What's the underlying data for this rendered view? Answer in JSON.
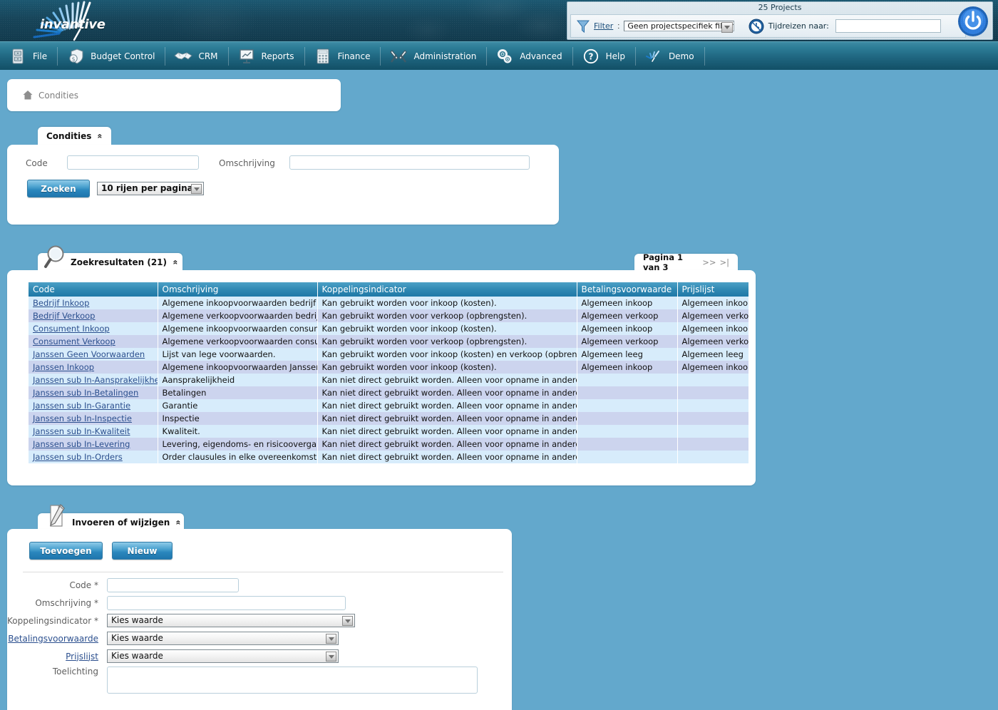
{
  "header": {
    "logo_text": "invantive",
    "project_count": "25 Projects",
    "filter_label": "Filter",
    "filter_colon": ":",
    "filter_value": "Geen projectspecifiek filter",
    "timetravel_label": "Tijdreizen naar:",
    "timetravel_value": ""
  },
  "menu": [
    {
      "icon": "cabinet-icon",
      "label": "File"
    },
    {
      "icon": "money-shield-icon",
      "label": "Budget Control"
    },
    {
      "icon": "handshake-icon",
      "label": "CRM"
    },
    {
      "icon": "presentation-chart-icon",
      "label": "Reports"
    },
    {
      "icon": "calculator-icon",
      "label": "Finance"
    },
    {
      "icon": "tools-icon",
      "label": "Administration"
    },
    {
      "icon": "gears-icon",
      "label": "Advanced"
    },
    {
      "icon": "question-mark-icon",
      "label": "Help"
    },
    {
      "icon": "invantive-mark-icon",
      "label": "Demo"
    }
  ],
  "breadcrumb": {
    "icon": "home-icon",
    "label": "Condities"
  },
  "search_panel": {
    "tab_title": "Condities",
    "collapse_glyph": "«",
    "code_label": "Code",
    "code_value": "",
    "omschrijving_label": "Omschrijving",
    "omschrijving_value": "",
    "search_button": "Zoeken",
    "rows_per_page": "10 rijen per pagina"
  },
  "results_panel": {
    "tab_icon": "magnifier-icon",
    "tab_title": "Zoekresultaten (21)",
    "collapse_glyph": "«",
    "pager_text": "Pagina 1 van 3",
    "pager_next": ">>",
    "pager_last": ">|",
    "columns": [
      "Code",
      "Omschrijving",
      "Koppelingsindicator",
      "Betalingsvoorwaarde",
      "Prijslijst"
    ],
    "rows": [
      [
        "Bedrijf Inkoop",
        "Algemene inkoopvoorwaarden bedrijf",
        "Kan gebruikt worden voor inkoop (kosten).",
        "Algemeen inkoop",
        "Algemeen inkoop"
      ],
      [
        "Bedrijf Verkoop",
        "Algemene verkoopvoorwaarden bedrijf",
        "Kan gebruikt worden voor verkoop (opbrengsten).",
        "Algemeen verkoop",
        "Algemeen verkoop"
      ],
      [
        "Consument Inkoop",
        "Algemene inkoopvoorwaarden consument",
        "Kan gebruikt worden voor inkoop (kosten).",
        "Algemeen inkoop",
        "Algemeen inkoop"
      ],
      [
        "Consument Verkoop",
        "Algemene verkoopvoorwaarden consument",
        "Kan gebruikt worden voor verkoop (opbrengsten).",
        "Algemeen verkoop",
        "Algemeen verkoop"
      ],
      [
        "Janssen Geen Voorwaarden",
        "Lijst van lege voorwaarden.",
        "Kan gebruikt worden voor inkoop (kosten) en verkoop (opbrengsten).",
        "Algemeen leeg",
        "Algemeen leeg"
      ],
      [
        "Janssen Inkoop",
        "Algemene inkoopvoorwaarden Janssen",
        "Kan gebruikt worden voor inkoop (kosten).",
        "Algemeen inkoop",
        "Algemeen inkoop"
      ],
      [
        "Janssen sub In-Aansprakelijkheid",
        "Aansprakelijkheid",
        "Kan niet direct gebruikt worden. Alleen voor opname in andere condities.",
        "",
        ""
      ],
      [
        "Janssen sub In-Betalingen",
        "Betalingen",
        "Kan niet direct gebruikt worden. Alleen voor opname in andere condities.",
        "",
        ""
      ],
      [
        "Janssen sub In-Garantie",
        "Garantie",
        "Kan niet direct gebruikt worden. Alleen voor opname in andere condities.",
        "",
        ""
      ],
      [
        "Janssen sub In-Inspectie",
        "Inspectie",
        "Kan niet direct gebruikt worden. Alleen voor opname in andere condities.",
        "",
        ""
      ],
      [
        "Janssen sub In-Kwaliteit",
        "Kwaliteit.",
        "Kan niet direct gebruikt worden. Alleen voor opname in andere condities.",
        "",
        ""
      ],
      [
        "Janssen sub In-Levering",
        "Levering, eigendoms- en risicoovergang",
        "Kan niet direct gebruikt worden. Alleen voor opname in andere condities.",
        "",
        ""
      ],
      [
        "Janssen sub In-Orders",
        "Order clausules in elke overeenkomst",
        "Kan niet direct gebruikt worden. Alleen voor opname in andere condities.",
        "",
        ""
      ]
    ]
  },
  "edit_panel": {
    "tab_icon": "note-pencil-icon",
    "tab_title": "Invoeren of wijzigen",
    "collapse_glyph": "«",
    "add_button": "Toevoegen",
    "new_button": "Nieuw",
    "fields": [
      {
        "label": "Code *",
        "type": "text",
        "value": ""
      },
      {
        "label": "Omschrijving *",
        "type": "text",
        "value": ""
      },
      {
        "label": "Koppelingsindicator *",
        "type": "select",
        "value": "Kies waarde"
      },
      {
        "label": "Betalingsvoorwaarde",
        "type": "select",
        "value": "Kies waarde",
        "is_link": true
      },
      {
        "label": "Prijslijst",
        "type": "select",
        "value": "Kies waarde",
        "is_link": true
      },
      {
        "label": "Toelichting",
        "type": "textarea",
        "value": ""
      }
    ]
  },
  "colors": {
    "page_background": "#63a8cc",
    "banner_dark": "#17455a",
    "menu_blue": "#1f6680",
    "table_header": "#2e87b2",
    "row_odd": "#d7ecfb",
    "row_even": "#ccd4ee",
    "link": "#2b4f8e",
    "button_blue": "#2a86bd"
  }
}
